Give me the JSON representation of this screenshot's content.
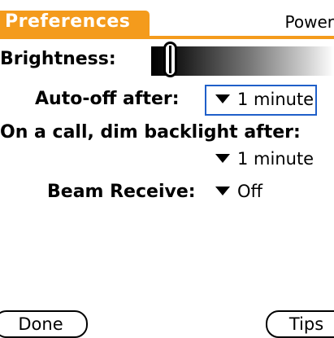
{
  "header": {
    "title": "Preferences",
    "category": "Power"
  },
  "brightness": {
    "label": "Brightness:",
    "level": 0.07
  },
  "auto_off": {
    "label": "Auto-off after:",
    "value": "1 minute"
  },
  "call_dim": {
    "label": "On a call, dim backlight after:",
    "value": "1 minute"
  },
  "beam": {
    "label": "Beam Receive:",
    "value": "Off"
  },
  "buttons": {
    "done": "Done",
    "tips": "Tips"
  },
  "colors": {
    "accent": "#f49b1c",
    "focus": "#1f5fc9"
  }
}
